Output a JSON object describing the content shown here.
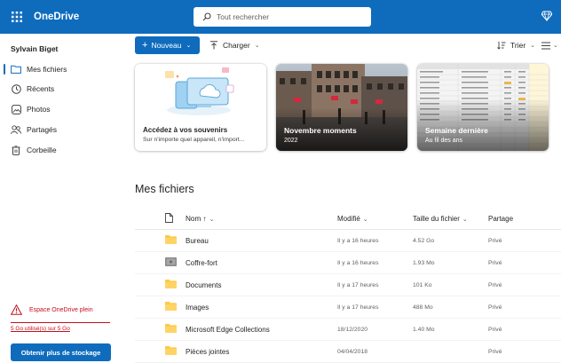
{
  "app": {
    "name": "OneDrive"
  },
  "search": {
    "placeholder": "Tout rechercher"
  },
  "sidebar": {
    "user": "Sylvain Biget",
    "items": [
      {
        "label": "Mes fichiers",
        "icon": "folder-icon",
        "active": true
      },
      {
        "label": "Récents",
        "icon": "clock-icon"
      },
      {
        "label": "Photos",
        "icon": "image-icon"
      },
      {
        "label": "Partagés",
        "icon": "people-icon"
      },
      {
        "label": "Corbeille",
        "icon": "trash-icon"
      }
    ],
    "storage_warning": "Espace OneDrive plein",
    "storage_usage": "5 Go utilisé(s) sur 5 Go",
    "buy_label": "Obtenir plus de stockage"
  },
  "toolbar": {
    "new_label": "Nouveau",
    "upload_label": "Charger",
    "sort_label": "Trier"
  },
  "cards": [
    {
      "title": "Accédez à vos souvenirs",
      "subtitle": "Sur n'importe quel appareil, n'import..."
    },
    {
      "title": "Novembre moments",
      "subtitle": "2022"
    },
    {
      "title": "Semaine dernière",
      "subtitle": "Au fil des ans"
    }
  ],
  "section_title": "Mes fichiers",
  "table": {
    "headers": {
      "name": "Nom ↑",
      "modified": "Modifié",
      "size": "Taille du fichier",
      "sharing": "Partage"
    },
    "rows": [
      {
        "name": "Bureau",
        "modified": "Il y a 16 heures",
        "size": "4.52 Go",
        "sharing": "Privé",
        "type": "folder"
      },
      {
        "name": "Coffre-fort",
        "modified": "Il y a 16 heures",
        "size": "1.93 Mo",
        "sharing": "Privé",
        "type": "vault"
      },
      {
        "name": "Documents",
        "modified": "Il y a 17 heures",
        "size": "101 Ko",
        "sharing": "Privé",
        "type": "folder"
      },
      {
        "name": "Images",
        "modified": "Il y a 17 heures",
        "size": "488 Mo",
        "sharing": "Privé",
        "type": "folder"
      },
      {
        "name": "Microsoft Edge Collections",
        "modified": "18/12/2020",
        "size": "1.40 Mo",
        "sharing": "Privé",
        "type": "folder"
      },
      {
        "name": "Pièces jointes",
        "modified": "04/04/2018",
        "size": "",
        "sharing": "Privé",
        "type": "folder"
      }
    ]
  },
  "colors": {
    "brand": "#0f6cbd",
    "warning": "#c50f1f",
    "folder": "#ffc83d"
  }
}
